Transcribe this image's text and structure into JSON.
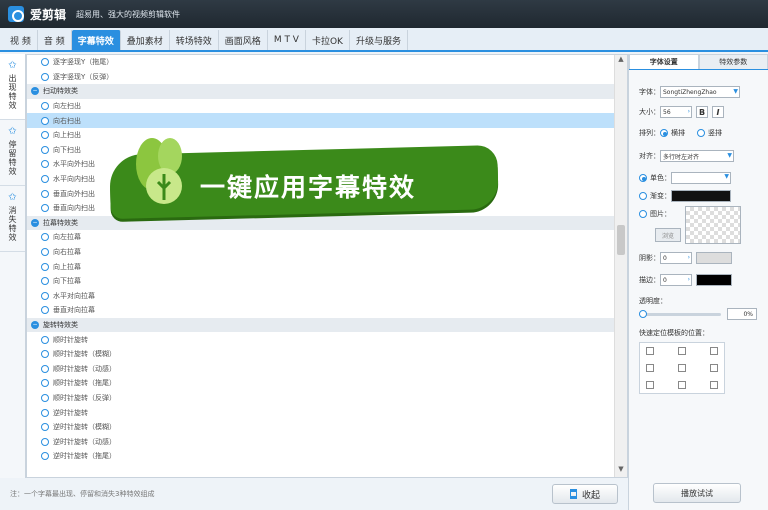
{
  "app": {
    "name": "爱剪辑",
    "slogan": "超易用、强大的视频剪辑软件"
  },
  "tabs": [
    {
      "label": "视 频"
    },
    {
      "label": "音 频"
    },
    {
      "label": "字幕特效"
    },
    {
      "label": "叠加素材"
    },
    {
      "label": "转场特效"
    },
    {
      "label": "画面风格"
    },
    {
      "label": "M T V"
    },
    {
      "label": "卡拉OK"
    },
    {
      "label": "升级与服务"
    }
  ],
  "active_tab": 2,
  "sidebar": [
    {
      "label": "出现特效"
    },
    {
      "label": "停留特效"
    },
    {
      "label": "消失特效"
    }
  ],
  "effect_list": [
    {
      "type": "item",
      "label": "逐字竖现Y（拖尾）"
    },
    {
      "type": "item",
      "label": "逐字竖现Y（反弹）"
    },
    {
      "type": "category",
      "label": "扫动特效类"
    },
    {
      "type": "item",
      "label": "向左扫出"
    },
    {
      "type": "item",
      "label": "向右扫出",
      "selected": true
    },
    {
      "type": "item",
      "label": "向上扫出"
    },
    {
      "type": "item",
      "label": "向下扫出"
    },
    {
      "type": "item",
      "label": "水平向外扫出"
    },
    {
      "type": "item",
      "label": "水平向内扫出"
    },
    {
      "type": "item",
      "label": "垂直向外扫出"
    },
    {
      "type": "item",
      "label": "垂直向内扫出"
    },
    {
      "type": "category",
      "label": "拉幕特效类"
    },
    {
      "type": "item",
      "label": "向左拉幕"
    },
    {
      "type": "item",
      "label": "向右拉幕"
    },
    {
      "type": "item",
      "label": "向上拉幕"
    },
    {
      "type": "item",
      "label": "向下拉幕"
    },
    {
      "type": "item",
      "label": "水平对向拉幕"
    },
    {
      "type": "item",
      "label": "垂直对向拉幕"
    },
    {
      "type": "category",
      "label": "旋转特效类"
    },
    {
      "type": "item",
      "label": "顺时针旋转"
    },
    {
      "type": "item",
      "label": "顺时针旋转（模糊）"
    },
    {
      "type": "item",
      "label": "顺时针旋转（动感）"
    },
    {
      "type": "item",
      "label": "顺时针旋转（拖尾）"
    },
    {
      "type": "item",
      "label": "顺时针旋转（反弹）"
    },
    {
      "type": "item",
      "label": "逆时针旋转"
    },
    {
      "type": "item",
      "label": "逆时针旋转（模糊）"
    },
    {
      "type": "item",
      "label": "逆时针旋转（动感）"
    },
    {
      "type": "item",
      "label": "逆时针旋转（拖尾）"
    }
  ],
  "banner": {
    "text": "一键应用字幕特效"
  },
  "bottom": {
    "hint": "注：一个字幕最出现、停留和消失3种特效组成",
    "collapse_label": "收起"
  },
  "right_panel": {
    "tabs": [
      {
        "label": "字体设置"
      },
      {
        "label": "特效参数"
      }
    ],
    "font_label": "字体：",
    "font_value": "SongtiZhengZhao",
    "size_label": "大小：",
    "size_value": "56",
    "bold_label": "B",
    "italic_label": "I",
    "arrange_label": "排列：",
    "arrange_horizontal": "横排",
    "arrange_vertical": "竖排",
    "align_label": "对齐：",
    "align_value": "多行时左对齐",
    "solid_label": "单色：",
    "gradient_label": "渐变：",
    "image_label": "图片：",
    "browse_label": "浏览",
    "shadow_label": "阴影：",
    "shadow_value": "0",
    "stroke_label": "描边：",
    "stroke_value": "0",
    "opacity_label": "透明度：",
    "opacity_value": "0%",
    "opacity_fraction": 0,
    "position_label": "快速定位模板的位置：",
    "apply_label": "播放试试"
  }
}
